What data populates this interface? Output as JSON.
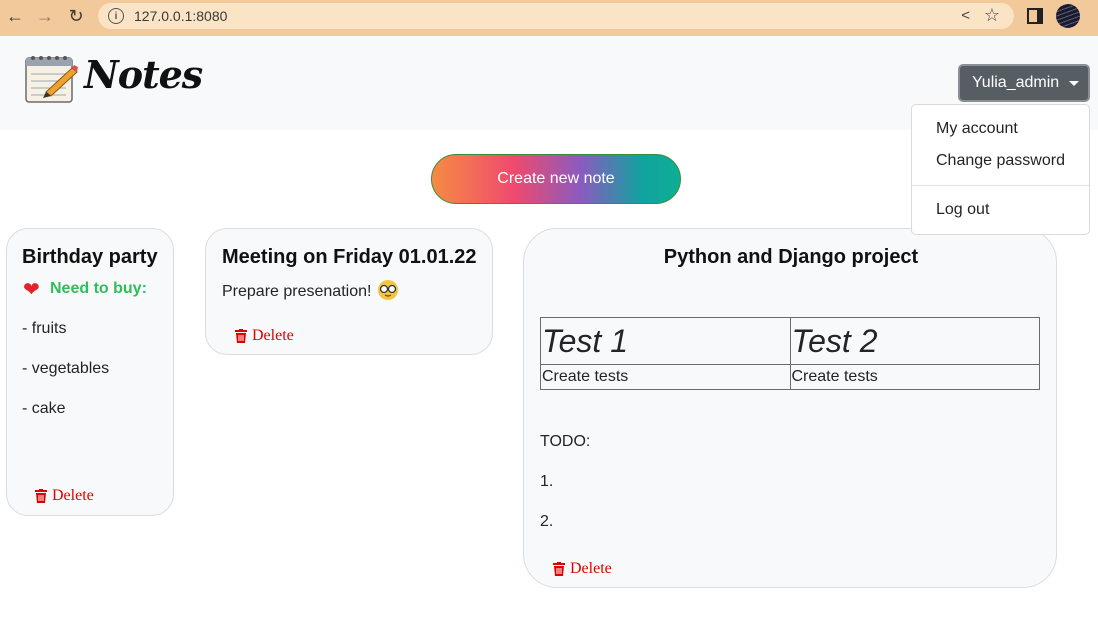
{
  "browser": {
    "url": "127.0.0.1:8080"
  },
  "header": {
    "logo_text": "Notes",
    "user_button": "Yulia_admin"
  },
  "dropdown": {
    "items": [
      "My account",
      "Change password",
      "Log out"
    ]
  },
  "create_button": "Create new note",
  "colors": {
    "delete": "#e00000",
    "need_to_buy": "#2fbf5a",
    "user_button": "#565e64"
  },
  "notes": [
    {
      "title": "Birthday party",
      "subtitle": "Need to buy:",
      "lines": [
        "- fruits",
        "- vegetables",
        "- cake"
      ],
      "delete": "Delete"
    },
    {
      "title": "Meeting on Friday 01.01.22",
      "text": "Prepare presenation!",
      "delete": "Delete"
    },
    {
      "title": "Python and Django project",
      "table": {
        "headers": [
          "Test 1",
          "Test 2"
        ],
        "row": [
          "Create tests",
          "Create tests"
        ]
      },
      "lines": [
        "TODO:",
        "1.",
        "2."
      ],
      "delete": "Delete"
    }
  ]
}
